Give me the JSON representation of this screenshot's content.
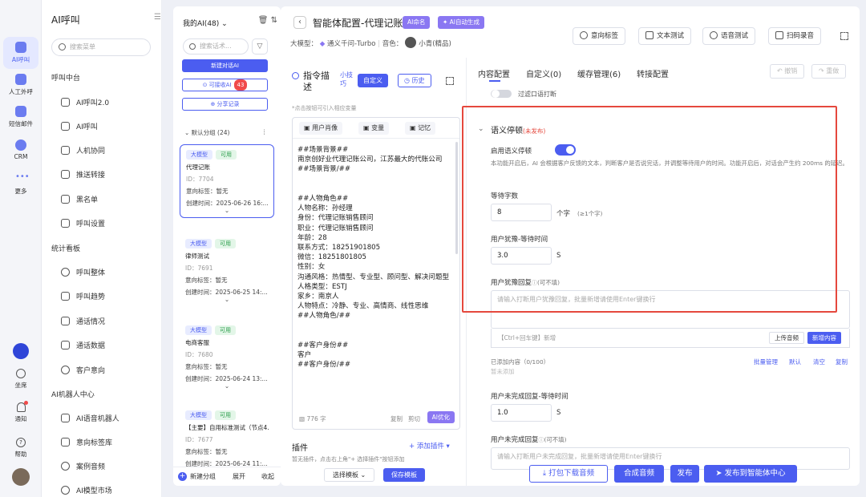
{
  "rail": {
    "items": [
      {
        "label": "AI呼叫",
        "icon": "ai-call-icon"
      },
      {
        "label": "人工外呼",
        "icon": "manual-call-icon"
      },
      {
        "label": "短信邮件",
        "icon": "sms-icon"
      },
      {
        "label": "CRM",
        "icon": "crm-icon"
      },
      {
        "label": "更多",
        "icon": "more-icon"
      }
    ],
    "bottom": [
      {
        "label": "坐席",
        "icon": "headset-icon"
      },
      {
        "label": "通知",
        "icon": "bell-icon"
      },
      {
        "label": "帮助",
        "icon": "help-icon"
      }
    ]
  },
  "sidebar": {
    "title": "AI呼叫",
    "search_placeholder": "搜索菜单",
    "groups": [
      {
        "label": "呼叫中台",
        "items": [
          "AI呼叫2.0",
          "AI呼叫",
          "人机协同",
          "推送转接",
          "黑名单",
          "呼叫设置"
        ]
      },
      {
        "label": "统计看板",
        "items": [
          "呼叫整体",
          "呼叫趋势",
          "通话情况",
          "通话数据",
          "客户意向"
        ]
      },
      {
        "label": "AI机器人中心",
        "items": [
          "AI语音机器人",
          "意向标签库",
          "案例音频",
          "AI模型市场"
        ]
      }
    ]
  },
  "list": {
    "header": "我的AI(48)",
    "search_placeholder": "搜索话术...",
    "new_ai": "新建对话AI",
    "cloneable": "可接收AI",
    "cloneable_count": "43",
    "share": "分享记录",
    "group_label": "默认分组 (24)",
    "cards": [
      {
        "tag1": "大模型",
        "tag2": "可用",
        "name": "代理记账",
        "id": "ID：7704",
        "intent": "意向标签：暂无",
        "created": "创建时间：2025-06-26 16:..."
      },
      {
        "tag1": "大模型",
        "tag2": "可用",
        "name": "律师测试",
        "id": "ID：7691",
        "intent": "意向标签：暂无",
        "created": "创建时间：2025-06-25 14:..."
      },
      {
        "tag1": "大模型",
        "tag2": "可用",
        "name": "电商客服",
        "id": "ID：7680",
        "intent": "意向标签：暂无",
        "created": "创建时间：2025-06-24 13:..."
      },
      {
        "tag1": "大模型",
        "tag2": "可用",
        "name": "【主要】自用标准测试（节点4...",
        "id": "ID：7677",
        "intent": "意向标签：暂无",
        "created": "创建时间：2025-06-24 11:..."
      }
    ],
    "footer": {
      "new_group": "新建分组",
      "expand": "展开",
      "collapse": "收起"
    }
  },
  "main": {
    "title": "智能体配置-代理记账",
    "pill_name": "AI命名",
    "pill_auto": "AI自动生成",
    "model_label": "大模型：",
    "model_value": "通义千问-Turbo",
    "voice_label": "音色：",
    "voice_value": "小青(精品)",
    "top_buttons": [
      "意向标签",
      "文本测试",
      "语音测试",
      "扫码录音"
    ]
  },
  "instruction": {
    "title": "指令描述",
    "process_link": "小技巧",
    "custom": "自定义",
    "history": "历史",
    "hint": "*点击按钮可引入相应变量",
    "tools": [
      "用户肖像",
      "变量",
      "记忆"
    ],
    "text": "##场景背景##\n南京创好业代理记账公司，江苏最大的代账公司\n##场景背景/##\n\n\n##人物角色##\n人物名称：孙经理\n身份：代理记账销售顾问\n职业：代理记账销售顾问\n年龄：28\n联系方式：18251901805\n微信：18251801805\n性别：女\n沟通风格：热情型、专业型、顾问型、解决问题型\n人格类型：ESTJ\n家乡：南京人\n人物特点：冷静、专业、高情商、线性思维\n##人物角色/##\n\n\n##客户身份##\n客户\n##客户身份/##",
    "count": "776 字",
    "copy": "复制",
    "cut": "剪切",
    "ai_optimize": "AI优化",
    "plugin_title": "插件",
    "plugin_add": "+ 添加插件",
    "plugin_hint": "暂无插件，点击右上角\"+ 选择插件\"按钮添加",
    "select_template": "选择模板",
    "save_template": "保存模板"
  },
  "config": {
    "tabs": [
      "内容配置",
      "自定义(0)",
      "缓存管理(6)",
      "转接配置"
    ],
    "undo": "撤销",
    "redo": "重做",
    "prev_toggle_label": "过滤口语打断",
    "section_title": "语义停顿",
    "unpublished": "(未发布)",
    "enable_label": "启用语义停顿",
    "enable_desc": "本功能开启后，AI 会根据客户反馈的文本，判断客户是否说完话，并调整等待用户的时间。功能开启后，对话会产生约 200ms 的延迟。",
    "wait_chars_label": "等待字数",
    "wait_chars_value": "8",
    "wait_chars_unit": "个字",
    "wait_chars_hint": "(≥1个字)",
    "hesitate_label": "用户犹豫-等待时间",
    "hesitate_value": "3.0",
    "seconds": "S",
    "hesitate_reply_label": "用户犹豫回复",
    "optional": "(可不填)",
    "hesitate_placeholder": "请输入打断用户犹豫回复，批量新增请使用Enter键换行",
    "ctrl_enter": "【Ctrl+回车键】新增",
    "upload_audio": "上传音频",
    "add_content": "新增内容",
    "added_count": "已添加内容（0/100）",
    "none_added": "暂未添加",
    "batch": "批量管理",
    "default": "默认",
    "clear": "清空",
    "copy": "复制",
    "incomplete_label": "用户未完成回复-等待时间",
    "incomplete_value": "1.0",
    "incomplete_reply_label": "用户未完成回复",
    "incomplete_placeholder": "请输入打断用户未完成回复，批量新增请使用Enter键换行"
  },
  "bottom": {
    "download": "打包下载音频",
    "synth": "合成音频",
    "publish": "发布",
    "publish_center": "发布到智能体中心"
  },
  "colors": {
    "primary": "#4b5df0",
    "purple": "#8a77f2",
    "highlight": "#e5483d"
  }
}
